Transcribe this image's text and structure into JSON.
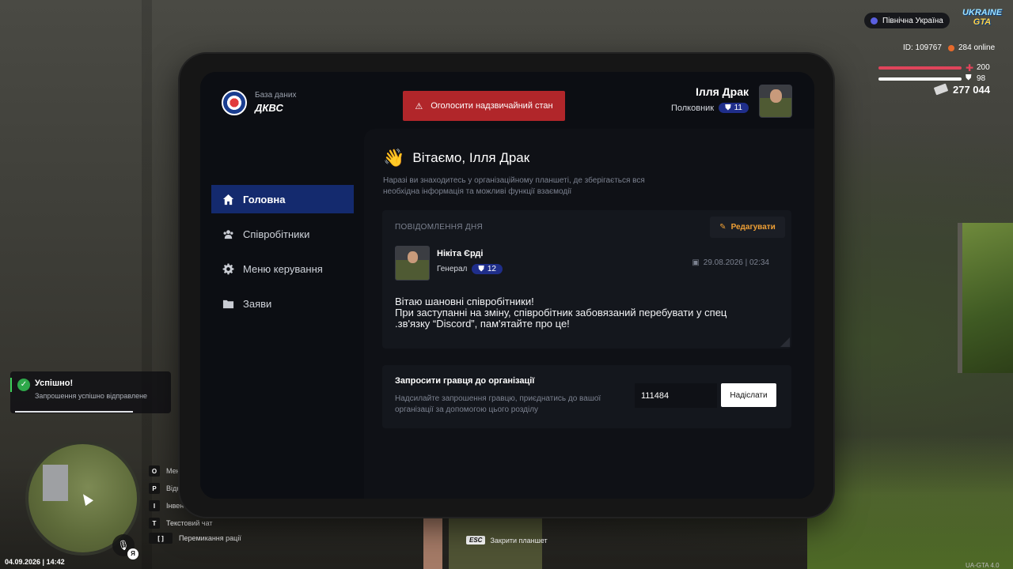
{
  "tablet": {
    "brand": {
      "subtitle": "База даних",
      "title": "ДКВС"
    },
    "nav": [
      {
        "label": "Головна",
        "icon": "home-icon",
        "active": true
      },
      {
        "label": "Співробітники",
        "icon": "users-icon",
        "active": false
      },
      {
        "label": "Меню керування",
        "icon": "gear-icon",
        "active": false
      },
      {
        "label": "Заяви",
        "icon": "folder-icon",
        "active": false
      }
    ],
    "alert_button": "Оголосити надзвичайний стан",
    "user": {
      "name": "Ілля Драк",
      "rank": "Полковник",
      "level": "11"
    },
    "welcome": {
      "emoji": "👋",
      "title": "Вітаємо, Ілля Драк",
      "description": "Наразі ви знаходитесь у організаційному планшеті, де зберігається вся необхідна інформація та можливі функції взаємодії"
    },
    "motd": {
      "title": "ПОВІДОМЛЕННЯ ДНЯ",
      "edit_label": "Редагувати",
      "author": "Нікіта Єрді",
      "author_rank": "Генерал",
      "author_level": "12",
      "date": "29.08.2026 | 02:34",
      "lines": [
        "Вітаю шановні співробітники!",
        "При заступанні на зміну, співробітник забовязаний перебувати у спец",
        ".зв'язку “Discord”, пам'ятайте про це!"
      ]
    },
    "invite": {
      "title": "Запросити гравця до організації",
      "description": "Надсилайте запрошення гравцю, приєднатись до вашої організації за допомогою цього розділу",
      "input_value": "111484",
      "button_label": "Надіслати"
    }
  },
  "hud": {
    "server": "Північна Україна",
    "logo_top": "UKRAINE",
    "logo_bottom": "GTA",
    "player_id": "ID: 109767",
    "online": "284 online",
    "health": "200",
    "armor": "98",
    "health_fraction": 1.0,
    "armor_fraction": 0.98,
    "money": "277 044",
    "toast": {
      "title": "Успішно!",
      "text": "Запрошення успішно відправлене"
    },
    "hints": [
      {
        "key": "O",
        "label": "Меню"
      },
      {
        "key": "P",
        "label": "Відк"
      },
      {
        "key": "I",
        "label": "Інвент"
      },
      {
        "key": "T",
        "label": "Текстовий чат"
      },
      {
        "key": "[ ]",
        "label": "Перемикання рації"
      }
    ],
    "mic_key": "Я",
    "datetime": "04.09.2026 | 14:42",
    "esc_key": "ESC",
    "esc_label": "Закрити планшет",
    "version": "UA-GTA 4.0"
  },
  "colors": {
    "accent_blue": "#142a6e",
    "alert_red": "#b1262a",
    "edit_orange": "#f0a035",
    "success_green": "#2ea84a"
  }
}
